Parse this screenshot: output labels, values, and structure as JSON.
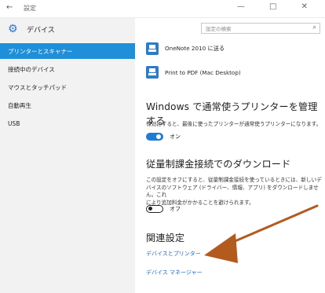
{
  "window": {
    "back_glyph": "←",
    "title": "設定",
    "controls": "—   □   ✕"
  },
  "sidebar": {
    "header_label": "デバイス",
    "items": [
      {
        "label": "プリンターとスキャナー",
        "active": true
      },
      {
        "label": "接続中のデバイス",
        "active": false
      },
      {
        "label": "マウスとタッチパッド",
        "active": false
      },
      {
        "label": "自動再生",
        "active": false
      },
      {
        "label": "USB",
        "active": false
      }
    ]
  },
  "search": {
    "placeholder": "設定の検索"
  },
  "printers": [
    {
      "name": "OneNote 2010 に送る"
    },
    {
      "name": "Print to PDF (Mac Desktop)"
    }
  ],
  "default_printer": {
    "heading": "Windows で通常使うプリンターを管理する",
    "description": "有効にすると、最後に使ったプリンターが通常使うプリンターになります。",
    "toggle_state": "オン"
  },
  "metered": {
    "heading": "従量制課金接続でのダウンロード",
    "description_lines": [
      "この設定をオフにすると、従量制課金接続を使っているときには、新しいデ",
      "バイスのソフトウェア (ドライバー、情報、アプリ) をダウンロードしません。これ",
      "により追加料金がかかることを避けられます。"
    ],
    "toggle_state": "オフ"
  },
  "related": {
    "heading": "関連設定",
    "links": [
      "デバイスとプリンター",
      "デバイス マネージャー"
    ]
  },
  "colors": {
    "accent": "#1e8fd8",
    "link": "#1e66c4",
    "annotation_arrow": "#b35a1f"
  }
}
